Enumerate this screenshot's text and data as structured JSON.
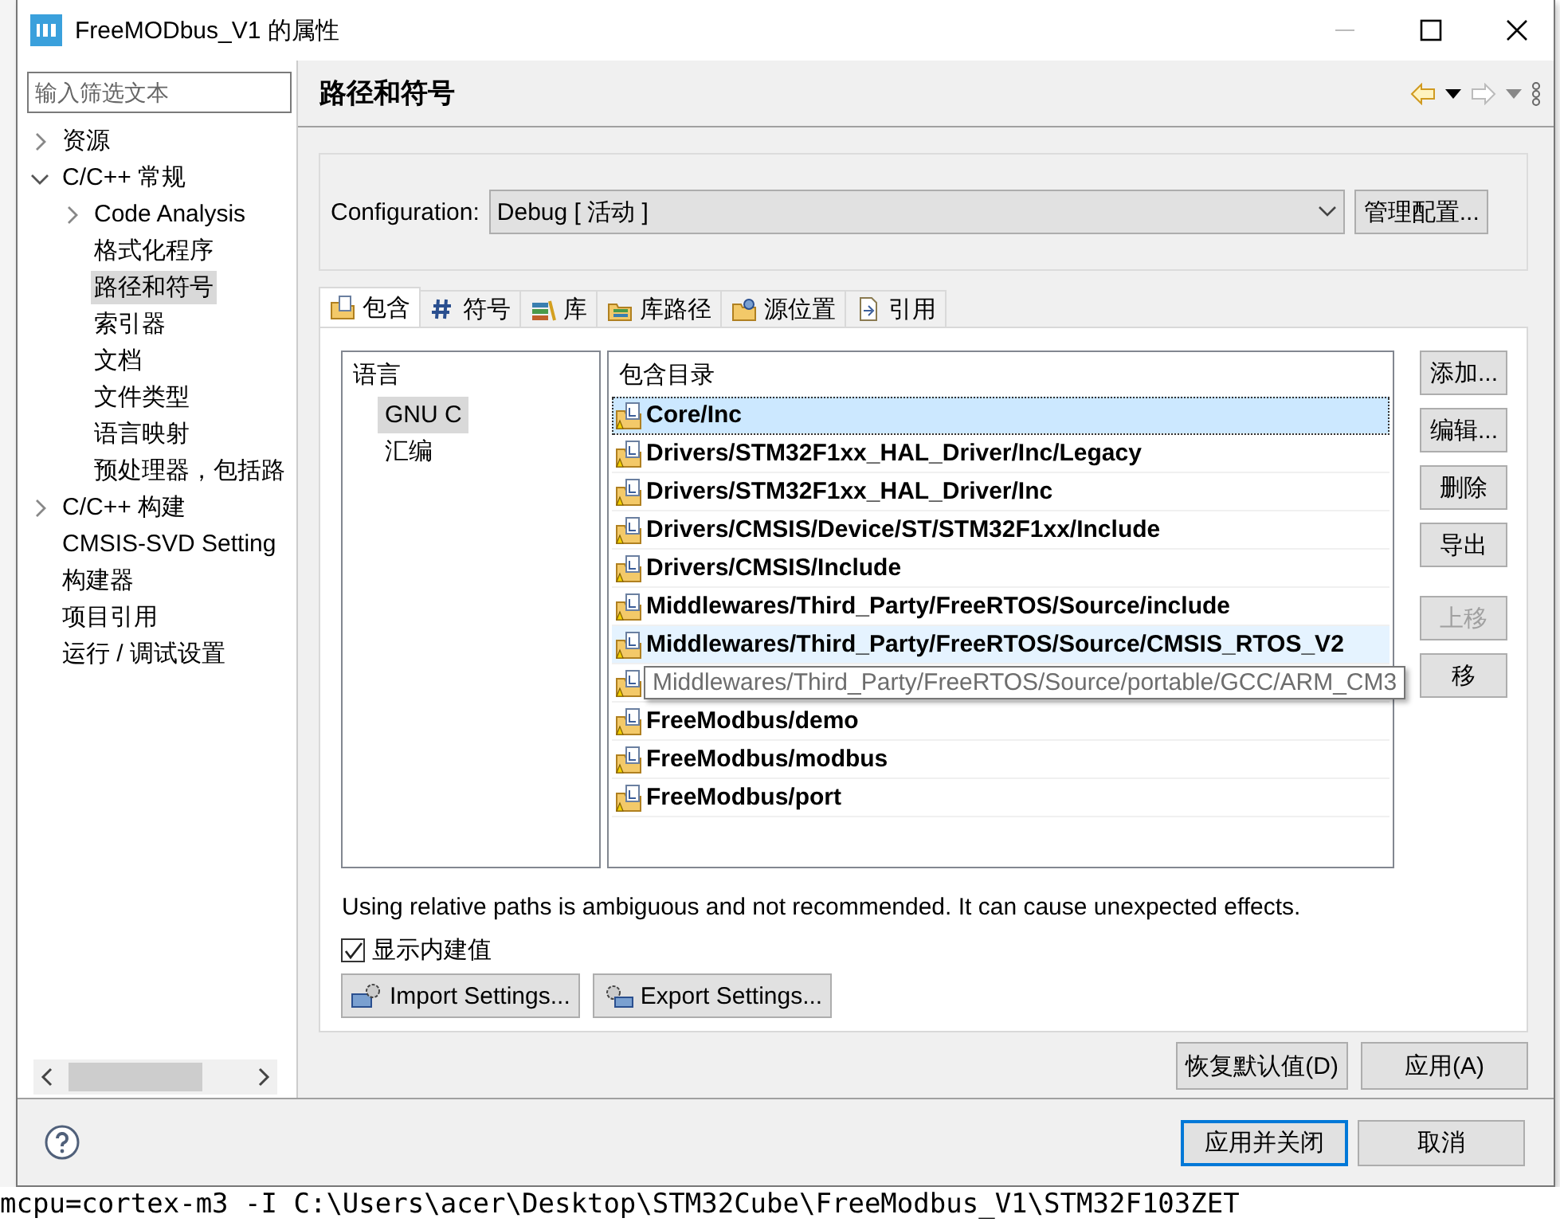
{
  "window": {
    "title": "FreeMODbus_V1 的属性"
  },
  "filter": {
    "placeholder": "输入筛选文本"
  },
  "sidebar": {
    "items": [
      {
        "label": "资源",
        "expanded": false,
        "selected": false
      },
      {
        "label": "C/C++ 常规",
        "expanded": true,
        "selected": false,
        "children": [
          {
            "label": "Code Analysis",
            "expanded": false,
            "selected": false
          },
          {
            "label": "格式化程序",
            "selected": false
          },
          {
            "label": "路径和符号",
            "selected": true
          },
          {
            "label": "索引器",
            "selected": false
          },
          {
            "label": "文档",
            "selected": false
          },
          {
            "label": "文件类型",
            "selected": false
          },
          {
            "label": "语言映射",
            "selected": false
          },
          {
            "label": "预处理器，包括路",
            "selected": false
          }
        ]
      },
      {
        "label": "C/C++ 构建",
        "expanded": false,
        "selected": false
      },
      {
        "label": "CMSIS-SVD Setting",
        "selected": false
      },
      {
        "label": "构建器",
        "selected": false
      },
      {
        "label": "项目引用",
        "selected": false
      },
      {
        "label": "运行 / 调试设置",
        "selected": false
      }
    ]
  },
  "page": {
    "title": "路径和符号"
  },
  "configuration": {
    "label": "Configuration:",
    "value": "Debug  [ 活动 ]",
    "button": "管理配置..."
  },
  "tabs": [
    {
      "label": "包含",
      "kind": "include",
      "selected": true
    },
    {
      "label": "符号",
      "kind": "symbol",
      "selected": false
    },
    {
      "label": "库",
      "kind": "library",
      "selected": false
    },
    {
      "label": "库路径",
      "kind": "libpath",
      "selected": false
    },
    {
      "label": "源位置",
      "kind": "source",
      "selected": false
    },
    {
      "label": "引用",
      "kind": "reference",
      "selected": false
    }
  ],
  "languages": {
    "header": "语言",
    "items": [
      {
        "label": "GNU C",
        "selected": true
      },
      {
        "label": "汇编",
        "selected": false
      }
    ]
  },
  "includes": {
    "header": "包含目录",
    "rows": [
      {
        "path": "Core/Inc",
        "selected": true,
        "hovered": false
      },
      {
        "path": "Drivers/STM32F1xx_HAL_Driver/Inc/Legacy",
        "selected": false,
        "hovered": false
      },
      {
        "path": "Drivers/STM32F1xx_HAL_Driver/Inc",
        "selected": false,
        "hovered": false
      },
      {
        "path": "Drivers/CMSIS/Device/ST/STM32F1xx/Include",
        "selected": false,
        "hovered": false
      },
      {
        "path": "Drivers/CMSIS/Include",
        "selected": false,
        "hovered": false
      },
      {
        "path": "Middlewares/Third_Party/FreeRTOS/Source/include",
        "selected": false,
        "hovered": false
      },
      {
        "path": "Middlewares/Third_Party/FreeRTOS/Source/CMSIS_RTOS_V2",
        "selected": false,
        "hovered": true
      },
      {
        "tooltip": "Middlewares/Third_Party/FreeRTOS/Source/portable/GCC/ARM_CM3",
        "selected": false,
        "hovered": false
      },
      {
        "path": "FreeModbus/demo",
        "selected": false,
        "hovered": false
      },
      {
        "path": "FreeModbus/modbus",
        "selected": false,
        "hovered": false
      },
      {
        "path": "FreeModbus/port",
        "selected": false,
        "hovered": false
      }
    ]
  },
  "edit_buttons": [
    {
      "label": "添加...",
      "disabled": false
    },
    {
      "label": "编辑...",
      "disabled": false
    },
    {
      "label": "删除",
      "disabled": false
    },
    {
      "label": "导出",
      "disabled": false
    }
  ],
  "move_buttons": [
    {
      "label": "上移",
      "disabled": true
    },
    {
      "label": "移",
      "disabled": false
    }
  ],
  "warning": "Using relative paths is ambiguous and not recommended. It can cause unexpected effects.",
  "show_builtin": {
    "label": "显示内建值",
    "checked": true
  },
  "settings_buttons": [
    {
      "label": "Import Settings...",
      "kind": "import"
    },
    {
      "label": "Export Settings...",
      "kind": "export"
    }
  ],
  "page_buttons": [
    "恢复默认值(D)",
    "应用(A)"
  ],
  "footer_buttons": [
    {
      "label": "应用并关闭",
      "default": true
    },
    {
      "label": "取消",
      "default": false
    }
  ],
  "background": {
    "console_line": "mcpu=cortex-m3 -I C:\\Users\\acer\\Desktop\\STM32Cube\\FreeModbus_V1\\STM32F103ZET"
  }
}
